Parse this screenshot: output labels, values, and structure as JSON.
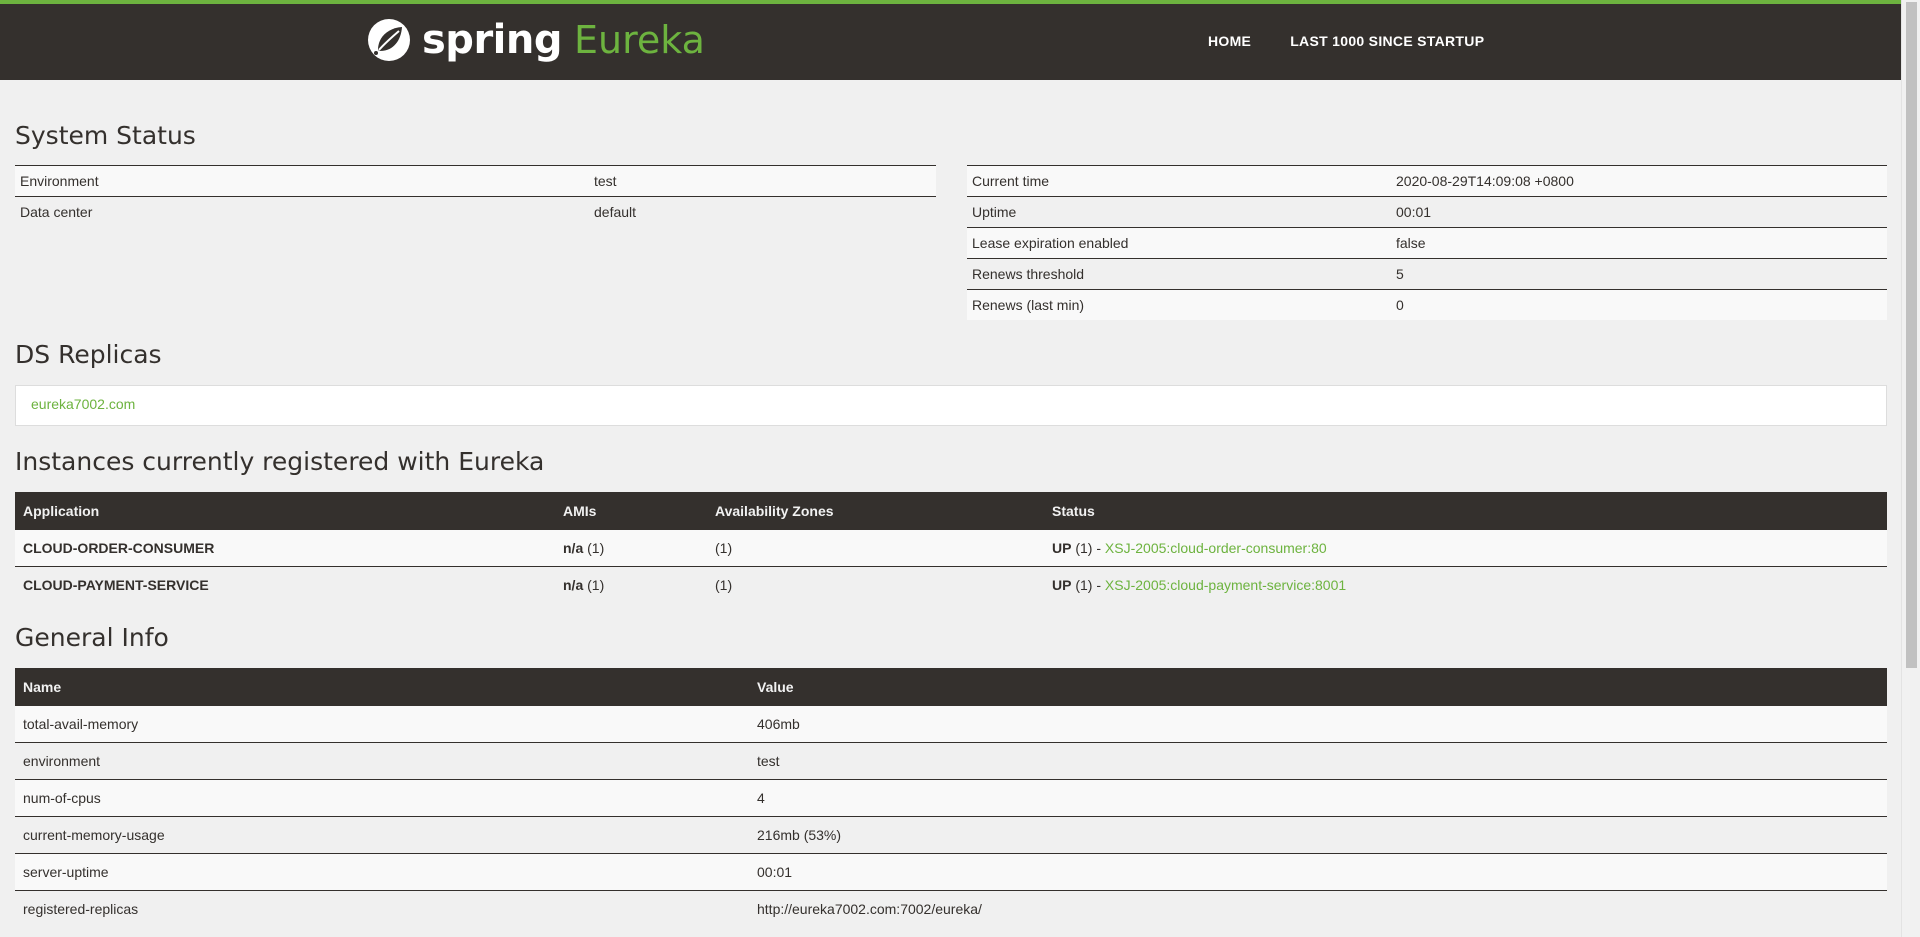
{
  "nav": {
    "brand_spring": "spring",
    "brand_eureka": "Eureka",
    "home": "HOME",
    "last1000": "LAST 1000 SINCE STARTUP"
  },
  "system_status": {
    "title": "System Status",
    "left": [
      {
        "label": "Environment",
        "value": "test"
      },
      {
        "label": "Data center",
        "value": "default"
      }
    ],
    "right": [
      {
        "label": "Current time",
        "value": "2020-08-29T14:09:08 +0800"
      },
      {
        "label": "Uptime",
        "value": "00:01"
      },
      {
        "label": "Lease expiration enabled",
        "value": "false"
      },
      {
        "label": "Renews threshold",
        "value": "5"
      },
      {
        "label": "Renews (last min)",
        "value": "0"
      }
    ]
  },
  "replicas": {
    "title": "DS Replicas",
    "items": [
      "eureka7002.com"
    ]
  },
  "instances": {
    "title": "Instances currently registered with Eureka",
    "headers": [
      "Application",
      "AMIs",
      "Availability Zones",
      "Status"
    ],
    "rows": [
      {
        "app": "CLOUD-ORDER-CONSUMER",
        "ami_bold": "n/a",
        "ami_count": " (1)",
        "zones": "(1)",
        "status_bold": "UP",
        "status_count": " (1) - ",
        "instance": "XSJ-2005:cloud-order-consumer:80"
      },
      {
        "app": "CLOUD-PAYMENT-SERVICE",
        "ami_bold": "n/a",
        "ami_count": " (1)",
        "zones": "(1)",
        "status_bold": "UP",
        "status_count": " (1) - ",
        "instance": "XSJ-2005:cloud-payment-service:8001"
      }
    ]
  },
  "general_info": {
    "title": "General Info",
    "headers": [
      "Name",
      "Value"
    ],
    "rows": [
      {
        "name": "total-avail-memory",
        "value": "406mb"
      },
      {
        "name": "environment",
        "value": "test"
      },
      {
        "name": "num-of-cpus",
        "value": "4"
      },
      {
        "name": "current-memory-usage",
        "value": "216mb (53%)"
      },
      {
        "name": "server-uptime",
        "value": "00:01"
      },
      {
        "name": "registered-replicas",
        "value": "http://eureka7002.com:7002/eureka/"
      }
    ]
  },
  "colors": {
    "brand_green": "#6db33f",
    "navbar_bg": "#34302d",
    "page_bg": "#f0f0f0"
  }
}
